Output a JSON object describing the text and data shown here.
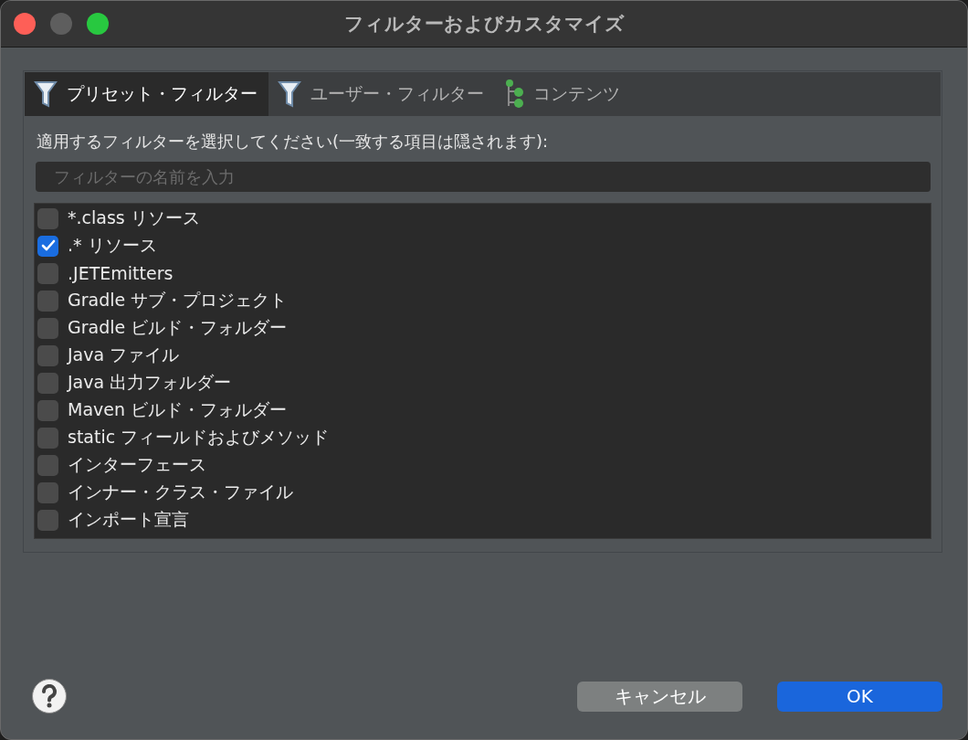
{
  "window": {
    "title": "フィルターおよびカスタマイズ"
  },
  "tabs": [
    {
      "label": "プリセット・フィルター",
      "selected": true,
      "kind": "filter"
    },
    {
      "label": "ユーザー・フィルター",
      "selected": false,
      "kind": "filter"
    },
    {
      "label": "コンテンツ",
      "selected": false,
      "kind": "tree"
    }
  ],
  "instruction": "適用するフィルターを選択してください(一致する項目は隠されます):",
  "search": {
    "placeholder": "フィルターの名前を入力"
  },
  "filters": [
    {
      "label": "*.class リソース",
      "checked": false
    },
    {
      "label": ".* リソース",
      "checked": true
    },
    {
      "label": ".JETEmitters",
      "checked": false
    },
    {
      "label": "Gradle サブ・プロジェクト",
      "checked": false
    },
    {
      "label": "Gradle ビルド・フォルダー",
      "checked": false
    },
    {
      "label": "Java ファイル",
      "checked": false
    },
    {
      "label": "Java 出力フォルダー",
      "checked": false
    },
    {
      "label": "Maven ビルド・フォルダー",
      "checked": false
    },
    {
      "label": "static フィールドおよびメソッド",
      "checked": false
    },
    {
      "label": "インターフェース",
      "checked": false
    },
    {
      "label": "インナー・クラス・ファイル",
      "checked": false
    },
    {
      "label": "インポート宣言",
      "checked": false
    }
  ],
  "buttons": [
    {
      "label": "キャンセル",
      "kind": "secondary"
    },
    {
      "label": "OK",
      "kind": "primary"
    }
  ]
}
